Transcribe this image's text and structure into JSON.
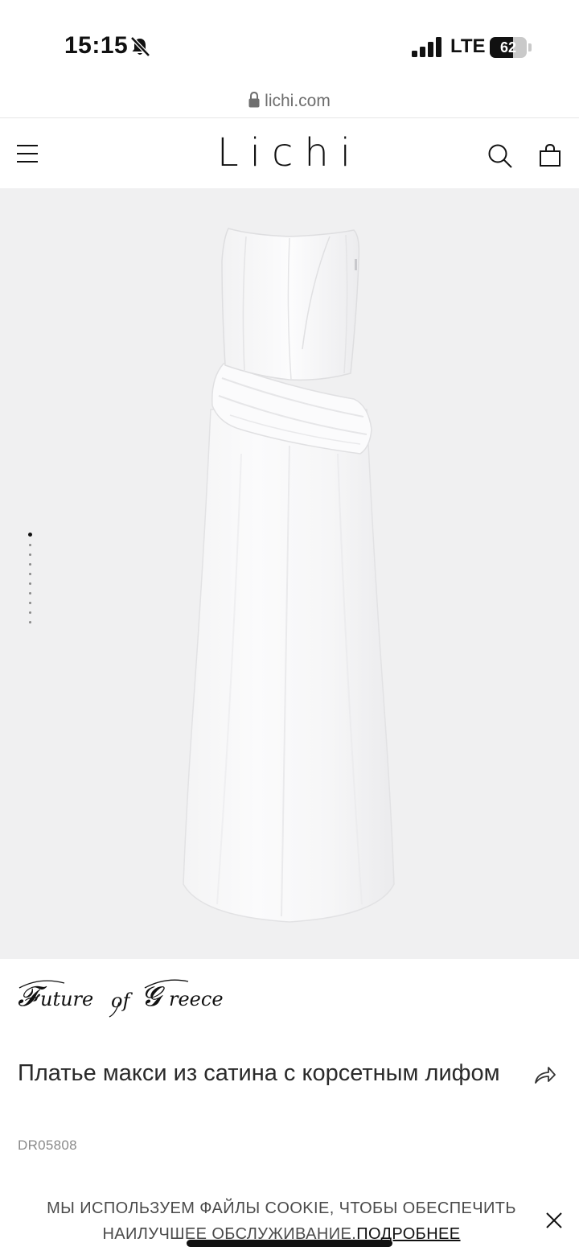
{
  "status_bar": {
    "time": "15:15",
    "network": "LTE",
    "battery_level": "62",
    "battery_fraction": 0.62,
    "icons": [
      "bell-slash-icon",
      "signal-icon",
      "battery-icon"
    ]
  },
  "browser": {
    "url": "lichi.com",
    "icons": [
      "lock-icon"
    ]
  },
  "header": {
    "logo": "Lichi",
    "icons": [
      "menu-icon",
      "search-icon",
      "bag-icon"
    ]
  },
  "gallery": {
    "image_count": 10,
    "active_index": 0,
    "background": "#f0f0f1"
  },
  "product": {
    "brand": "Future of Greece",
    "title": "Платье макси из сатина с корсетным лифом",
    "sku": "DR05808",
    "icons": [
      "share-icon"
    ]
  },
  "cookie_banner": {
    "text": "МЫ ИСПОЛЬЗУЕМ ФАЙЛЫ COOKIE, ЧТОБЫ ОБЕСПЕЧИТЬ НАИЛУЧШЕЕ ОБСЛУЖИВАНИЕ.",
    "link": "ПОДРОБНЕЕ",
    "icons": [
      "close-icon"
    ]
  }
}
